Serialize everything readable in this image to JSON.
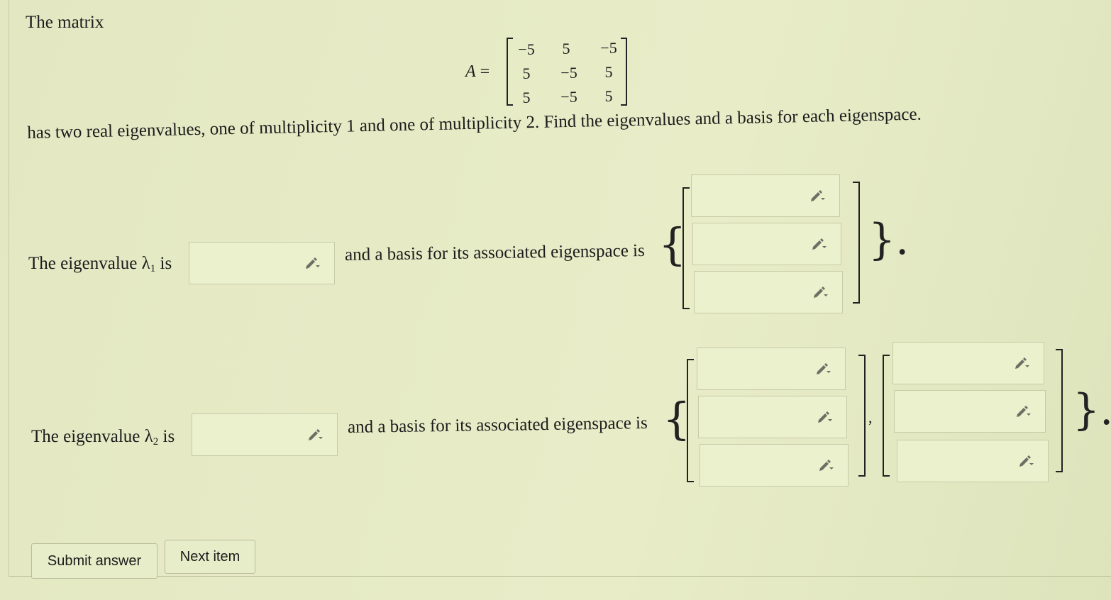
{
  "intro_text": "The matrix",
  "matrix": {
    "name": "A",
    "equals": "=",
    "rows": [
      [
        "−5",
        "5",
        "−5"
      ],
      [
        "5",
        "−5",
        "5"
      ],
      [
        "5",
        "−5",
        "5"
      ]
    ]
  },
  "problem_text": "has two real eigenvalues, one of multiplicity 1 and one of multiplicity 2. Find the eigenvalues and a basis for each eigenspace.",
  "eigen1": {
    "prefix": "The eigenvalue λ",
    "subscript": "1",
    "suffix": "is",
    "value": "",
    "basis_text": "and a basis for its associated eigenspace is",
    "vector": [
      "",
      "",
      ""
    ],
    "closing": "}."
  },
  "eigen2": {
    "prefix": "The eigenvalue λ",
    "subscript": "2",
    "suffix": "is",
    "value": "",
    "basis_text": "and a basis for its associated eigenspace is",
    "vector1": [
      "",
      "",
      ""
    ],
    "separator": ",",
    "vector2": [
      "",
      "",
      ""
    ],
    "closing": "}."
  },
  "buttons": {
    "submit": "Submit answer",
    "next": "Next item"
  },
  "icons": {
    "input_icon": "pencil-dropdown-icon"
  }
}
